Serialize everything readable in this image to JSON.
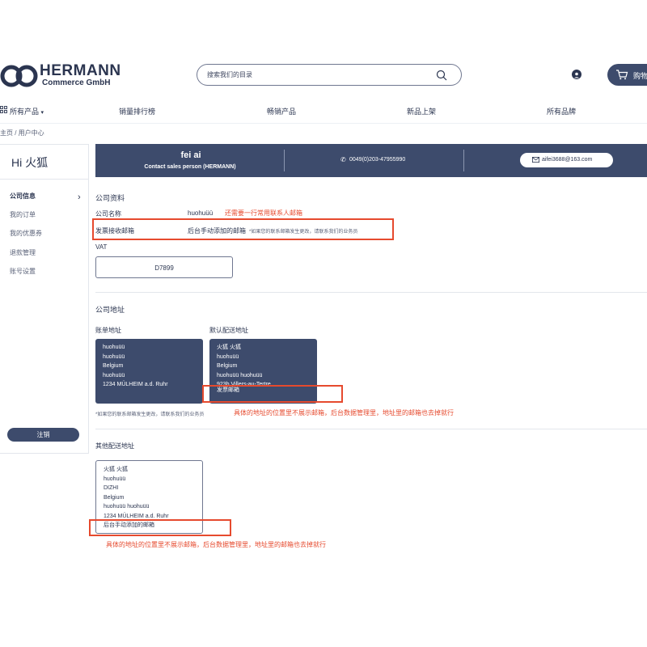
{
  "header": {
    "brand_title": "HERMANN",
    "brand_subtitle": "Commerce GmbH",
    "search_placeholder": "搜索我们的目录",
    "cart_label": "购物车",
    "colors": {
      "brand": "#2b3550",
      "primary_button": "#3d4b6c",
      "annotation_red": "#e64a2e"
    }
  },
  "nav": {
    "items": [
      "所有产品",
      "销量排行榜",
      "畅销产品",
      "新品上架",
      "所有品牌"
    ]
  },
  "breadcrumb": "主页 / 用户中心",
  "sidebar": {
    "greeting": "Hi 火狐",
    "items": [
      "公司信息",
      "我的订单",
      "我的优惠券",
      "退款管理",
      "账号设置"
    ],
    "logout_label": "注销"
  },
  "banner": {
    "name": "fei ai",
    "subtitle": "Contact sales person (HERMANN)",
    "phone": "0049(0)203-47955990",
    "email": "aifei3688@163.com"
  },
  "company_profile": {
    "title": "公司资料",
    "company_name_label": "公司名称",
    "company_name_value": "huohuüü",
    "annotation_add_email": "还需要一行常用联系人邮箱",
    "invoice_email_label": "发票接收邮箱",
    "invoice_email_value": "后台手动添加的邮箱",
    "invoice_email_note": "*如果您的联系邮箱发生更改，请联系我们的业务员",
    "vat_label": "VAT",
    "vat_value": "D7899"
  },
  "company_address": {
    "title": "公司地址",
    "billing_label": "账单地址",
    "billing_lines": [
      "huohuüü",
      "huohuüü",
      "Belgium",
      "huohuüü",
      "1234 MÜLHEIM a.d. Ruhr"
    ],
    "shipping_label": "默认配送地址",
    "shipping_lines": [
      "火狐 火狐",
      "huohuüü",
      "Belgium",
      "huohuüü huohuüü",
      "923b Villers-au-Tertre",
      "发票邮箱"
    ],
    "note": "*如果您的联系邮箱发生更改，请联系我们的业务员",
    "annotation": "具体的地址的位置里不展示邮箱，后台数据管理里，地址里的邮箱也去掉就行"
  },
  "other_address": {
    "title": "其他配送地址",
    "lines": [
      "火狐 火狐",
      "huohuüü",
      "DIZHI",
      "Belgium",
      "huohuüü huohuüü",
      "1234 MÜLHEIM a.d. Ruhr",
      "后台手动添加的邮箱"
    ],
    "annotation": "具体的地址的位置里不展示邮箱，后台数据管理里，地址里的邮箱也去掉就行"
  }
}
